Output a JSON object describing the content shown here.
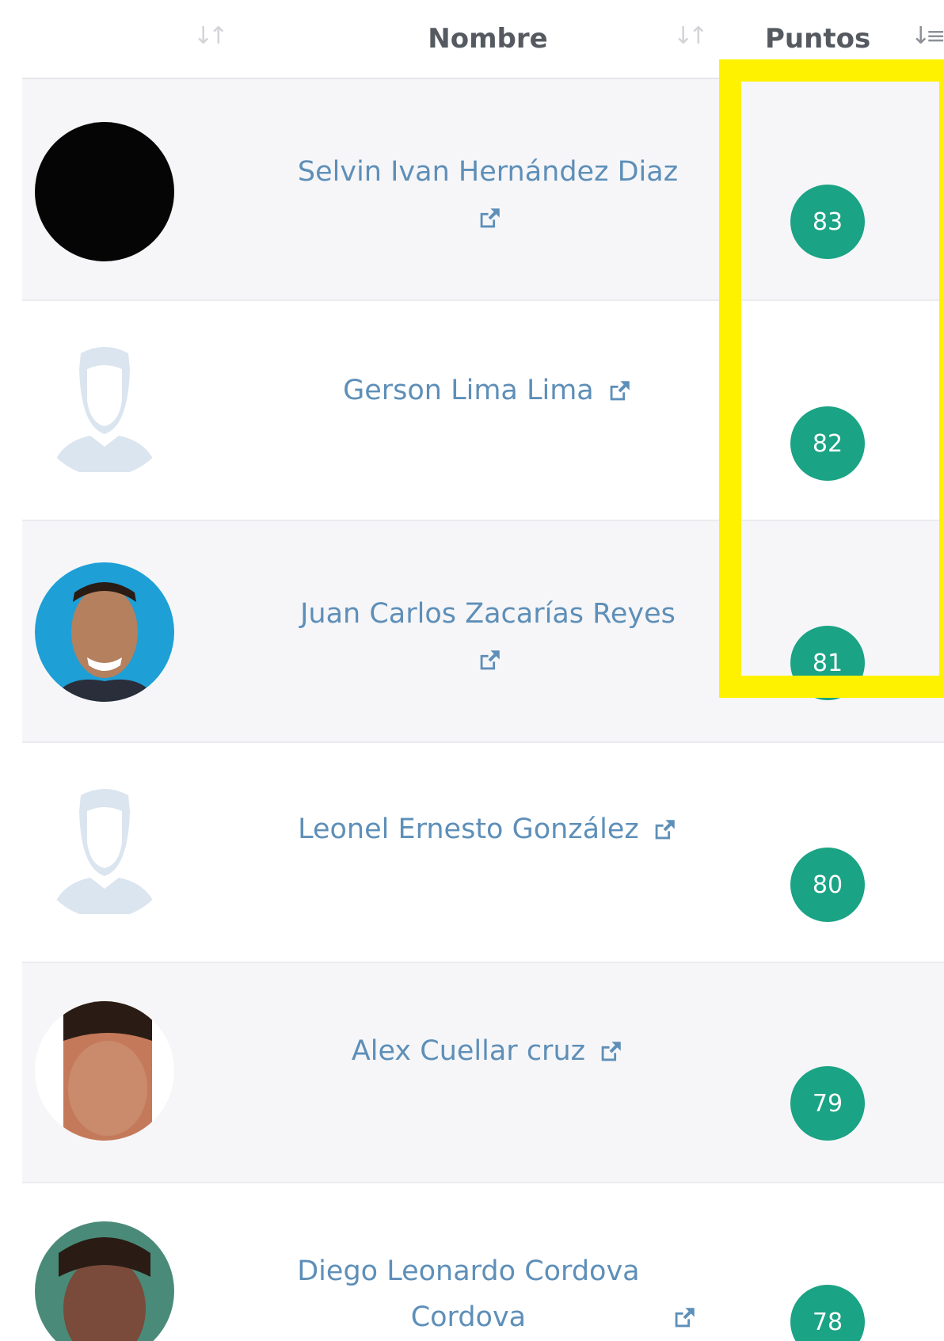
{
  "table": {
    "headers": {
      "avatar_col": "",
      "name_col": "Nombre",
      "points_col": "Puntos"
    },
    "rows": [
      {
        "name": "Selvin Ivan Hernández Diaz",
        "points": "83",
        "avatar": "avatar-dark"
      },
      {
        "name": "Gerson Lima Lima",
        "points": "82",
        "avatar": "avatar-placeholder-icon"
      },
      {
        "name": "Juan Carlos Zacarías Reyes",
        "points": "81",
        "avatar": "avatar-photo"
      },
      {
        "name": "Leonel Ernesto González",
        "points": "80",
        "avatar": "avatar-placeholder-icon"
      },
      {
        "name": "Alex Cuellar cruz",
        "points": "79",
        "avatar": "avatar-photo"
      },
      {
        "name": "Diego Leonardo Cordova Cordova",
        "points": "78",
        "avatar": "avatar-photo"
      }
    ]
  },
  "colors": {
    "badge": "#1aa384",
    "link": "#5e8fb8",
    "highlight": "#fff200"
  },
  "icons": {
    "sort": "sort-icon",
    "sort_active": "sort-desc-icon",
    "external_link": "external-link-icon"
  }
}
